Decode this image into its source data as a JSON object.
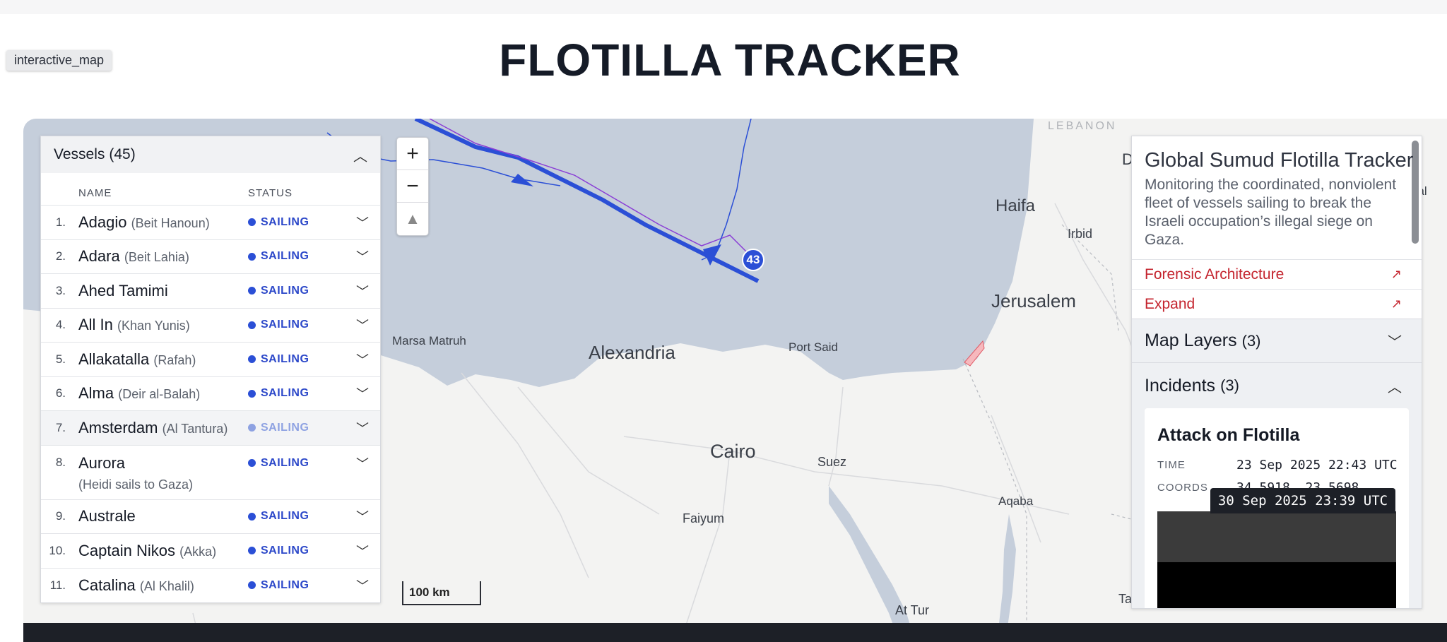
{
  "tag": "interactive_map",
  "page_title": "FLOTILLA TRACKER",
  "vessels_panel": {
    "title": "Vessels",
    "count": "(45)",
    "col_name": "NAME",
    "col_status": "STATUS",
    "rows": [
      {
        "num": "1.",
        "name": "Adagio",
        "sub": "(Beit Hanoun)",
        "status": "SAILING"
      },
      {
        "num": "2.",
        "name": "Adara",
        "sub": "(Beit Lahia)",
        "status": "SAILING"
      },
      {
        "num": "3.",
        "name": "Ahed Tamimi",
        "sub": "",
        "status": "SAILING"
      },
      {
        "num": "4.",
        "name": "All In",
        "sub": "(Khan Yunis)",
        "status": "SAILING"
      },
      {
        "num": "5.",
        "name": "Allakatalla",
        "sub": "(Rafah)",
        "status": "SAILING"
      },
      {
        "num": "6.",
        "name": "Alma",
        "sub": "(Deir al-Balah)",
        "status": "SAILING"
      },
      {
        "num": "7.",
        "name": "Amsterdam",
        "sub": "(Al Tantura)",
        "status": "SAILING"
      },
      {
        "num": "8.",
        "name": "Aurora",
        "sub": "(Heidi sails to Gaza)",
        "status": "SAILING"
      },
      {
        "num": "9.",
        "name": "Australe",
        "sub": "",
        "status": "SAILING"
      },
      {
        "num": "10.",
        "name": "Captain Nikos",
        "sub": "(Akka)",
        "status": "SAILING"
      },
      {
        "num": "11.",
        "name": "Catalina",
        "sub": "(Al Khalil)",
        "status": "SAILING"
      }
    ]
  },
  "map": {
    "places": [
      "LEBANON",
      "Haifa",
      "Irbid",
      "Jerusalem",
      "Marsa Matruh",
      "Alexandria",
      "Port Said",
      "Cairo",
      "Suez",
      "Faiyum",
      "Aqaba",
      "At Tur",
      "Ta",
      "D",
      "bal"
    ],
    "cluster_count": "43",
    "scale_label": "100 km",
    "colors": {
      "sea": "#c5cedb",
      "track": "#2b4fd6",
      "alt_track": "#8a3fd6",
      "gaza": "#f6b8bd"
    }
  },
  "right_panel": {
    "title": "Global Sumud Flotilla Tracker",
    "description": "Monitoring the coordinated, nonviolent fleet of vessels sailing to break the Israeli occupation’s illegal siege on Gaza.",
    "link1": "Forensic Architecture",
    "link2": "Expand",
    "layers_title": "Map Layers",
    "layers_count": "(3)",
    "incidents_title": "Incidents",
    "incidents_count": "(3)",
    "incident": {
      "title": "Attack on Flotilla",
      "time_label": "TIME",
      "time_value": "23 Sep 2025 22:43 UTC",
      "coords_label": "COORDS",
      "coords_value": "34.5918, 23.5698"
    }
  },
  "timestamp": "30 Sep 2025 23:39 UTC",
  "icons": {
    "zoom_in": "plus-icon",
    "zoom_out": "minus-icon",
    "compass": "compass-icon",
    "chevron": "chevron-icon",
    "external": "arrow-up-right-icon"
  }
}
